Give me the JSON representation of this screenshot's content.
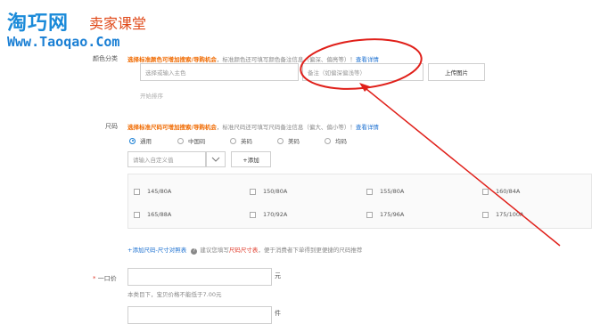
{
  "logo": {
    "brand": "淘巧网",
    "subtitle": "卖家课堂",
    "url": "Www.Taoqao.Com"
  },
  "color_section": {
    "label": "颜色分类",
    "hint_highlight": "选择标准颜色可增加搜索/导购机会",
    "hint_text": "，标准颜色还可填写颜色备注信息（偏深、偏亮等）！",
    "hint_link": "查看详情",
    "main_color_placeholder": "选择或输入主色",
    "remark_placeholder": "备注（如偏深偏浅等）",
    "upload_button": "上传图片",
    "sort_link": "开始排序"
  },
  "size_section": {
    "label": "尺码",
    "hint_highlight": "选择标准尺码可增加搜索/导购机会",
    "hint_text": "，标准尺码还可填写尺码备注信息（偏大、偏小等）！",
    "hint_link": "查看详情",
    "radios": [
      {
        "label": "通用",
        "checked": true
      },
      {
        "label": "中国码",
        "checked": false
      },
      {
        "label": "英码",
        "checked": false
      },
      {
        "label": "美码",
        "checked": false
      },
      {
        "label": "均码",
        "checked": false
      }
    ],
    "custom_placeholder": "请输入自定义值",
    "add_button": "+添加",
    "sizes": [
      "145/80A",
      "150/80A",
      "155/80A",
      "160/84A",
      "165/88A",
      "170/92A",
      "175/96A",
      "175/100A"
    ],
    "chart_link": "+添加尺码-尺寸对照表",
    "chart_hint_pre": "建议您填写",
    "chart_hint_red": "尺码尺寸表",
    "chart_hint_post": "，便于消费者下单得到更便捷的尺码推荐"
  },
  "price_section": {
    "required_mark": "*",
    "label": "一口价",
    "unit": "元",
    "note": "本类目下，宝贝价格不能低于7.00元",
    "unit2": "件"
  },
  "annotation_color": "#e0201a"
}
